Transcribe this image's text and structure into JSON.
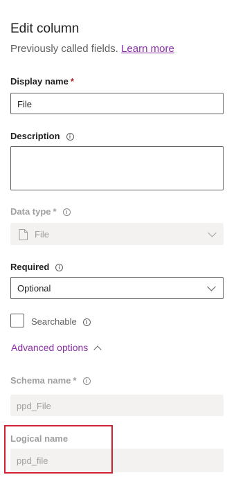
{
  "panel": {
    "title": "Edit column",
    "subtitle": "Previously called fields.",
    "learn_more": "Learn more"
  },
  "display_name": {
    "label": "Display name",
    "required_mark": "*",
    "value": "File"
  },
  "description": {
    "label": "Description",
    "value": ""
  },
  "data_type": {
    "label": "Data type",
    "required_mark": "*",
    "value": "File",
    "icon": "file-icon"
  },
  "required": {
    "label": "Required",
    "value": "Optional"
  },
  "searchable": {
    "label": "Searchable",
    "checked": false
  },
  "advanced_options": {
    "label": "Advanced options"
  },
  "schema_name": {
    "label": "Schema name",
    "required_mark": "*",
    "value": "ppd_File"
  },
  "logical_name": {
    "label": "Logical name",
    "value": "ppd_file"
  },
  "colors": {
    "accent": "#8a2da5",
    "required": "#a4262c",
    "highlight": "#d1202f"
  }
}
